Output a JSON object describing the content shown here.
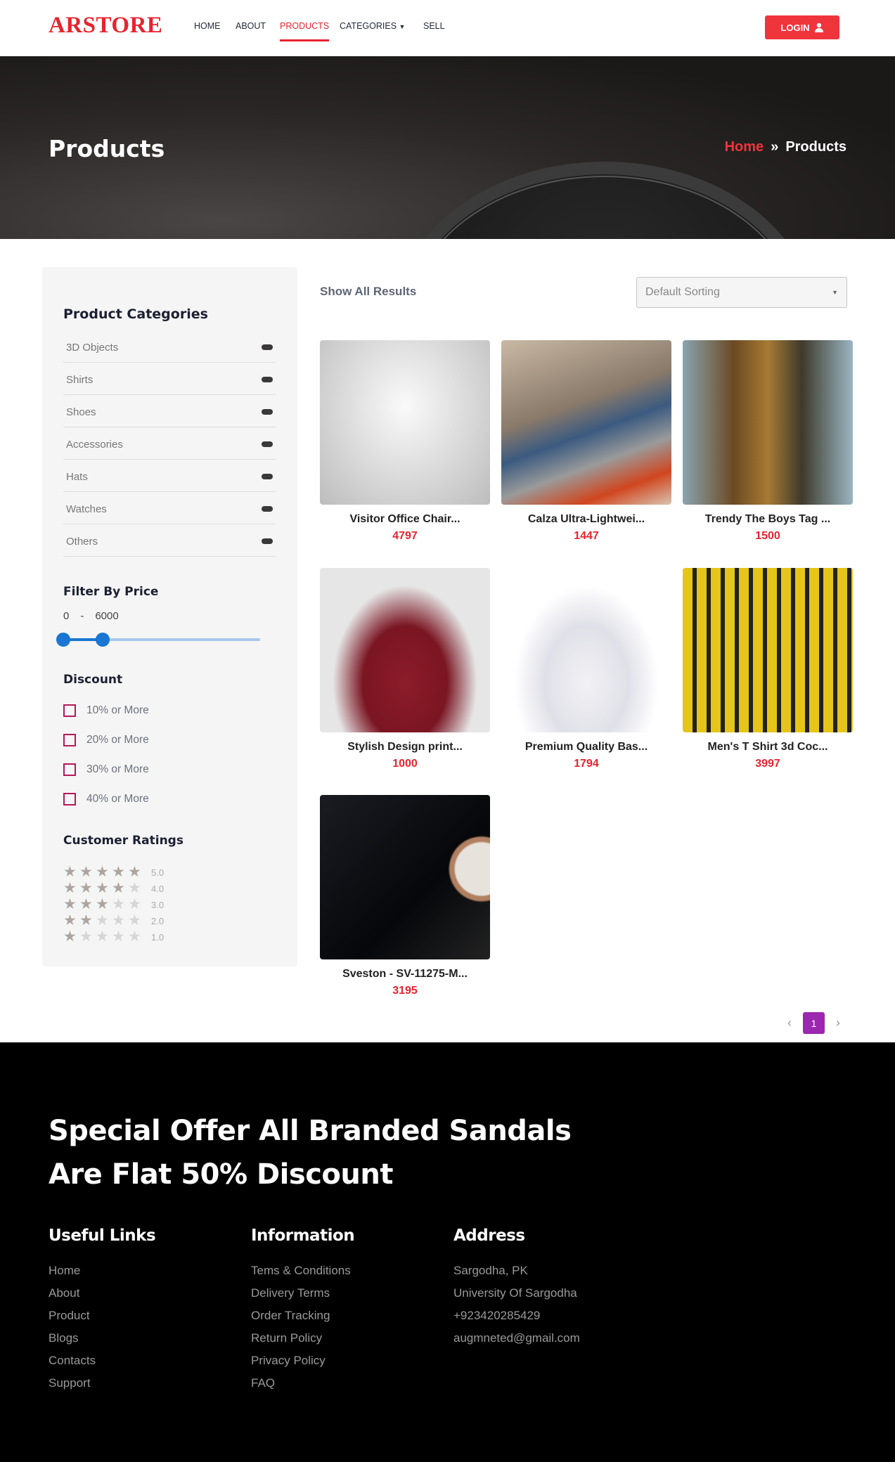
{
  "header": {
    "logo": "ARSTORE",
    "nav": [
      {
        "label": "HOME"
      },
      {
        "label": "ABOUT"
      },
      {
        "label": "PRODUCTS",
        "active": true
      },
      {
        "label": "CATEGORIES"
      },
      {
        "label": "SELL"
      }
    ],
    "login": "LOGIN",
    "accent": "#e8232e"
  },
  "hero": {
    "title": "Products",
    "breadcrumb": {
      "home": "Home",
      "separator": "»",
      "current": "Products"
    }
  },
  "sidebar": {
    "categories_title": "Product Categories",
    "categories": [
      "3D Objects",
      "Shirts",
      "Shoes",
      "Accessories",
      "Hats",
      "Watches",
      "Others"
    ],
    "price_title": "Filter By Price",
    "price": {
      "min": "0",
      "sep": "-",
      "max": "6000",
      "range_min": 0,
      "range_max": 6000,
      "slider_low_pct": 0,
      "slider_high_pct": 20
    },
    "discount_title": "Discount",
    "discounts": [
      "10% or More",
      "20% or More",
      "30% or More",
      "40% or More"
    ],
    "ratings_title": "Customer Ratings",
    "ratings": [
      {
        "label": "5.0",
        "stars": 5
      },
      {
        "label": "4.0",
        "stars": 4
      },
      {
        "label": "3.0",
        "stars": 3
      },
      {
        "label": "2.0",
        "stars": 2
      },
      {
        "label": "1.0",
        "stars": 1
      }
    ]
  },
  "main": {
    "show_all": "Show All Results",
    "sort": {
      "selected": "Default Sorting"
    },
    "products": [
      {
        "title": "Visitor Office Chair...",
        "price": "4797",
        "image": "chair"
      },
      {
        "title": "Calza Ultra-Lightwei...",
        "price": "1447",
        "image": "loafers"
      },
      {
        "title": "Trendy The Boys Tag ...",
        "price": "1500",
        "image": "plaid-shirt"
      },
      {
        "title": "Stylish Design print...",
        "price": "1000",
        "image": "maroon-polo"
      },
      {
        "title": "Premium Quality Bas...",
        "price": "1794",
        "image": "white-polo"
      },
      {
        "title": "Men's T Shirt 3d Coc...",
        "price": "3997",
        "image": "yellow-check-shirt"
      },
      {
        "title": "Sveston - SV-11275-M...",
        "price": "3195",
        "image": "watch"
      }
    ],
    "pagination": {
      "prev": "‹",
      "current": "1",
      "next": "›",
      "active_color": "#9c27b0"
    }
  },
  "footer": {
    "offer": "Special Offer All Branded Sandals Are Flat 50% Discount",
    "columns": [
      {
        "title": "Useful Links",
        "items": [
          "Home",
          "About",
          "Product",
          "Blogs",
          "Contacts",
          "Support"
        ]
      },
      {
        "title": "Information",
        "items": [
          "Tems & Conditions",
          "Delivery Terms",
          "Order Tracking",
          "Return Policy",
          "Privacy Policy",
          "FAQ"
        ]
      },
      {
        "title": "Address",
        "items": [
          "Sargodha, PK",
          "University Of Sargodha",
          "+923420285429",
          "augmneted@gmail.com"
        ]
      }
    ]
  }
}
